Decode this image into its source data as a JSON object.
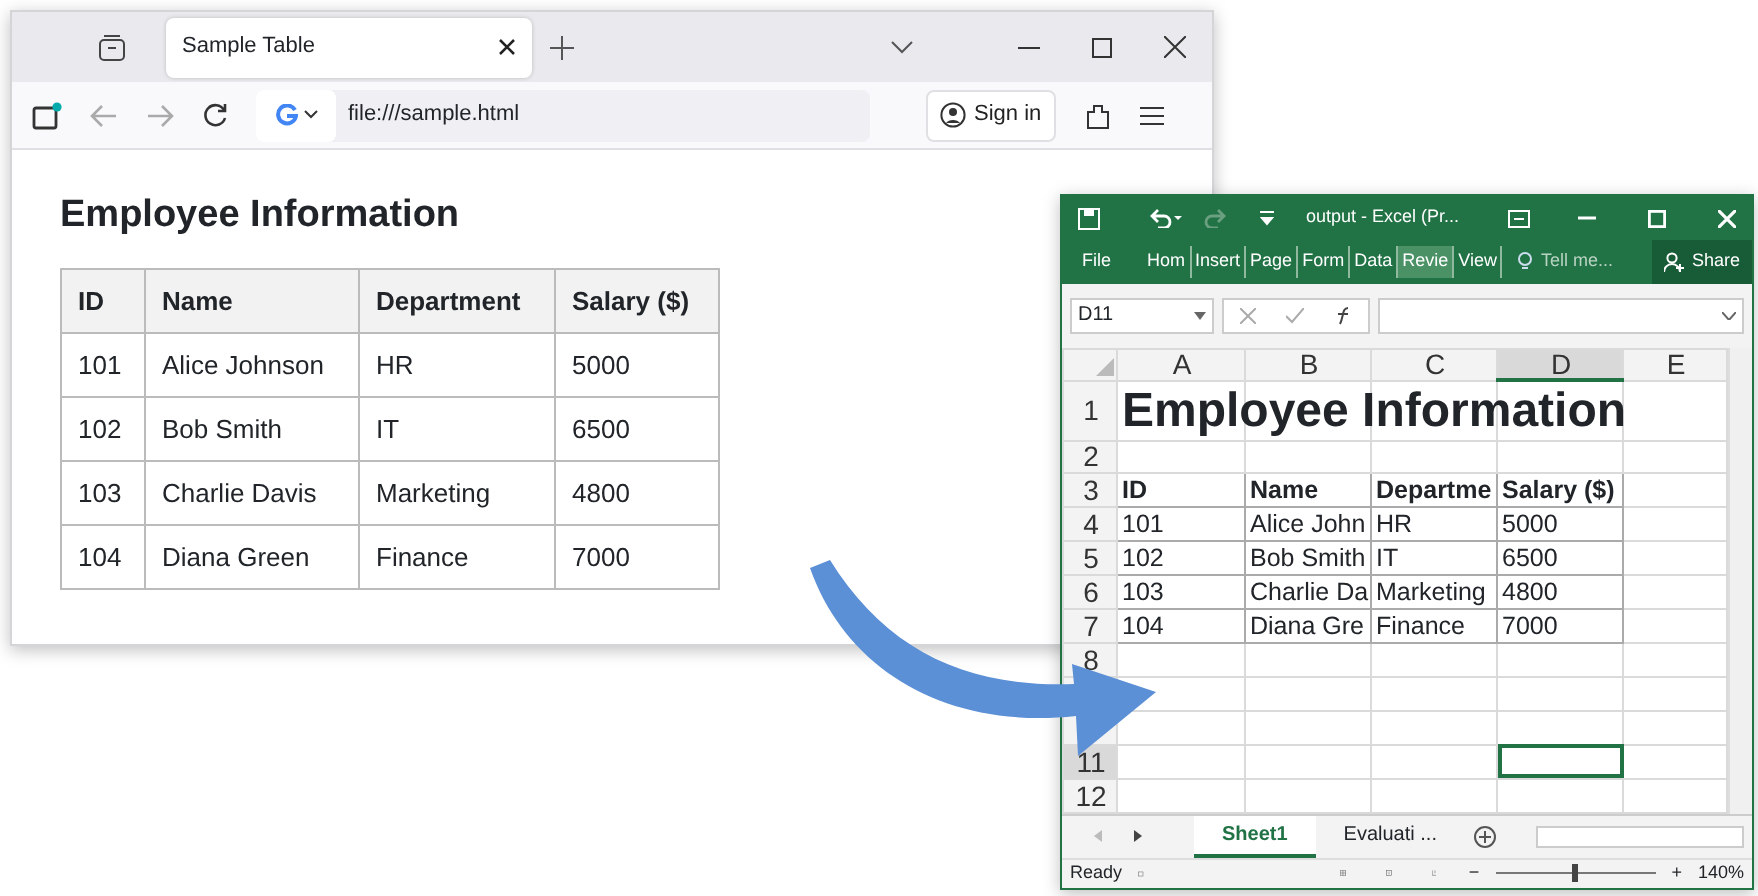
{
  "browser": {
    "tab_title": "Sample Table",
    "url": "file:///sample.html",
    "sign_in": "Sign in",
    "heading": "Employee Information",
    "table": {
      "columns": [
        "ID",
        "Name",
        "Department",
        "Salary ($)"
      ],
      "rows": [
        [
          "101",
          "Alice Johnson",
          "HR",
          "5000"
        ],
        [
          "102",
          "Bob Smith",
          "IT",
          "6500"
        ],
        [
          "103",
          "Charlie Davis",
          "Marketing",
          "4800"
        ],
        [
          "104",
          "Diana Green",
          "Finance",
          "7000"
        ]
      ]
    }
  },
  "excel": {
    "title": "output - Excel (Pr...",
    "ribbon_tabs": [
      {
        "label": "File",
        "selected": false
      },
      {
        "label": "Hom",
        "selected": false
      },
      {
        "label": "Insert",
        "selected": false
      },
      {
        "label": "Page",
        "selected": false
      },
      {
        "label": "Form",
        "selected": false
      },
      {
        "label": "Data",
        "selected": false
      },
      {
        "label": "Revie",
        "selected": true
      },
      {
        "label": "View",
        "selected": false
      }
    ],
    "tell_me": "Tell me...",
    "share": "Share",
    "name_box": "D11",
    "columns": [
      {
        "label": "A",
        "selected": false
      },
      {
        "label": "B",
        "selected": false
      },
      {
        "label": "C",
        "selected": false
      },
      {
        "label": "D",
        "selected": true
      },
      {
        "label": "E",
        "selected": false
      }
    ],
    "rows": [
      {
        "label": "1",
        "kind": "title",
        "cells": [
          "Employee Information"
        ],
        "selected": false
      },
      {
        "label": "2",
        "kind": "plain",
        "cells": [],
        "selected": false
      },
      {
        "label": "3",
        "kind": "header",
        "cells": [
          "ID",
          "Name",
          "Departme",
          "Salary ($)"
        ],
        "selected": false
      },
      {
        "label": "4",
        "kind": "plain",
        "cells": [
          "101",
          "Alice John",
          "HR",
          "5000"
        ],
        "selected": false
      },
      {
        "label": "5",
        "kind": "plain",
        "cells": [
          "102",
          "Bob Smith",
          "IT",
          "6500"
        ],
        "selected": false
      },
      {
        "label": "6",
        "kind": "plain",
        "cells": [
          "103",
          "Charlie Da",
          "Marketing",
          "4800"
        ],
        "selected": false
      },
      {
        "label": "7",
        "kind": "plain",
        "cells": [
          "104",
          "Diana Gre",
          "Finance",
          "7000"
        ],
        "selected": false
      },
      {
        "label": "8",
        "kind": "plain",
        "cells": [],
        "selected": false
      },
      {
        "kind": "plain",
        "cells": [],
        "selected": false
      },
      {
        "kind": "plain",
        "cells": [],
        "selected": false
      },
      {
        "label": "11",
        "kind": "plain",
        "cells": [],
        "selected": true
      },
      {
        "label": "12",
        "kind": "plain",
        "cells": [],
        "selected": false
      }
    ],
    "sheets": [
      {
        "label": "Sheet1",
        "selected": true
      },
      {
        "label": "Evaluati ...",
        "selected": false
      }
    ],
    "status": "Ready",
    "zoom_out": "−",
    "zoom_in": "+",
    "zoom": "140%",
    "zoom_slider": {
      "level": 0.5
    }
  }
}
